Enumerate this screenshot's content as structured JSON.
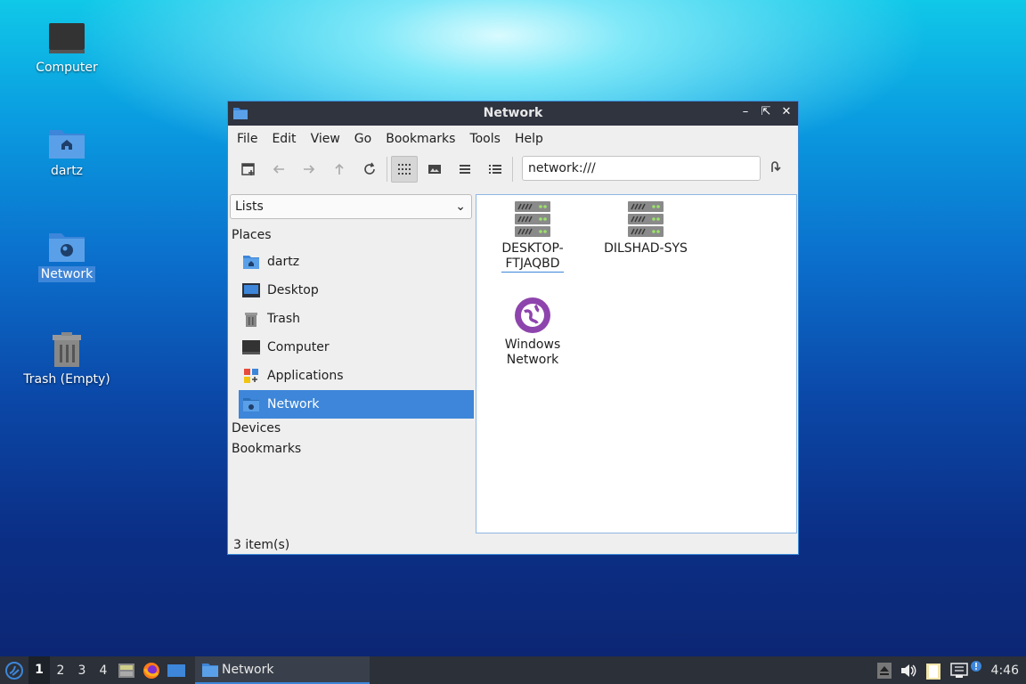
{
  "desktop": {
    "icons": [
      {
        "label": "Computer"
      },
      {
        "label": "dartz"
      },
      {
        "label": "Network"
      },
      {
        "label": "Trash (Empty)"
      }
    ]
  },
  "window": {
    "title": "Network",
    "menu": [
      "File",
      "Edit",
      "View",
      "Go",
      "Bookmarks",
      "Tools",
      "Help"
    ],
    "address": "network:///",
    "sidebar": {
      "mode": "Lists",
      "places_header": "Places",
      "places": [
        "dartz",
        "Desktop",
        "Trash",
        "Computer",
        "Applications",
        "Network"
      ],
      "devices_header": "Devices",
      "bookmarks_header": "Bookmarks"
    },
    "items": [
      {
        "label": "DESKTOP-\nFTJAQBD",
        "icon": "server-icon"
      },
      {
        "label": "DILSHAD-SYS",
        "icon": "server-icon"
      },
      {
        "label": "Windows\nNetwork",
        "icon": "network-globe-icon"
      }
    ],
    "status": "3 item(s)"
  },
  "taskbar": {
    "workspaces": [
      "1",
      "2",
      "3",
      "4"
    ],
    "task_label": "Network",
    "clock": "4:46"
  },
  "colors": {
    "accent": "#3d86d9",
    "titlebar": "#2f343f",
    "panel": "#2b3039"
  }
}
